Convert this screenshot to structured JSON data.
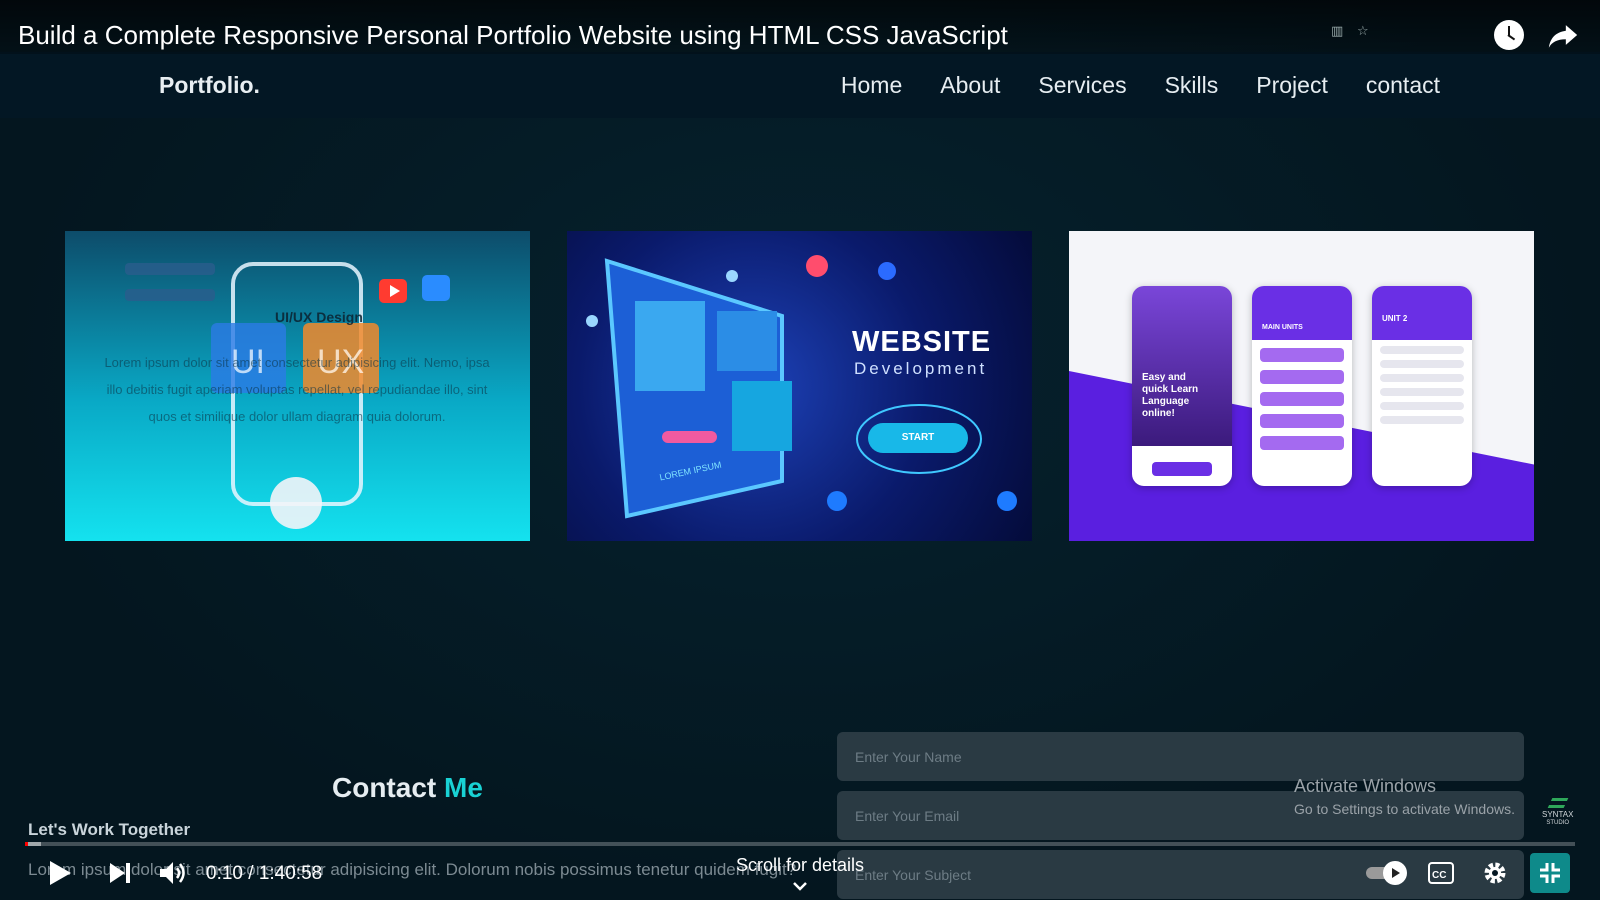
{
  "player": {
    "title": "Build a Complete Responsive Personal Portfolio Website using HTML CSS JavaScript",
    "time": "0:10 / 1:40:58",
    "progress_fraction": 0.0017,
    "scroll_hint": "Scroll for details"
  },
  "site": {
    "brand": "Portfolio.",
    "nav": [
      "Home",
      "About",
      "Services",
      "Skills",
      "Project",
      "contact"
    ]
  },
  "projects": {
    "card1": {
      "caption": "UI/UX Design",
      "body": "Lorem ipsum dolor sit amet consectetur adipisicing elit. Nemo, ipsa illo debitis fugit aperiam voluptas repellat, vel repudiandae illo, sint quos et similique dolor ullam diagram quia dolorum.",
      "badge_ui": "UI",
      "badge_ux": "UX"
    },
    "card2": {
      "title": "WEBSITE",
      "subtitle": "Development",
      "button": "START",
      "lorem": "LOREM IPSUM"
    },
    "card3": {
      "phone_text": "Easy and quick Learn Language online!",
      "phone2_head": "MAIN UNITS",
      "phone3_head": "UNIT 2"
    }
  },
  "contact": {
    "title_a": "Contact",
    "title_b": "Me",
    "subtitle": "Let's Work Together",
    "paragraph": "Lorem ipsum dolor sit amet consectetur adipisicing elit. Dolorum nobis possimus tenetur quidem fugit? Dolorum cupiditate deleniti perspiciatis ea soluta repellat dignissimos eum.",
    "name_placeholder": "Enter Your Name",
    "email_placeholder": "Enter Your Email",
    "subject_placeholder": "Enter Your Subject"
  },
  "overlay": {
    "activate_title": "Activate Windows",
    "activate_sub": "Go to Settings to activate Windows.",
    "syntax": "SYNTAX",
    "syntax_sub": "STUDIO"
  },
  "colors": {
    "accent": "#19d2d4",
    "progress": "#ff0000",
    "background": "#041722"
  },
  "icons": [
    "play-icon",
    "next-icon",
    "volume-icon",
    "watch-later-icon",
    "share-icon",
    "captions-icon",
    "gear-icon",
    "exit-fullscreen-icon",
    "autoplay-toggle"
  ]
}
